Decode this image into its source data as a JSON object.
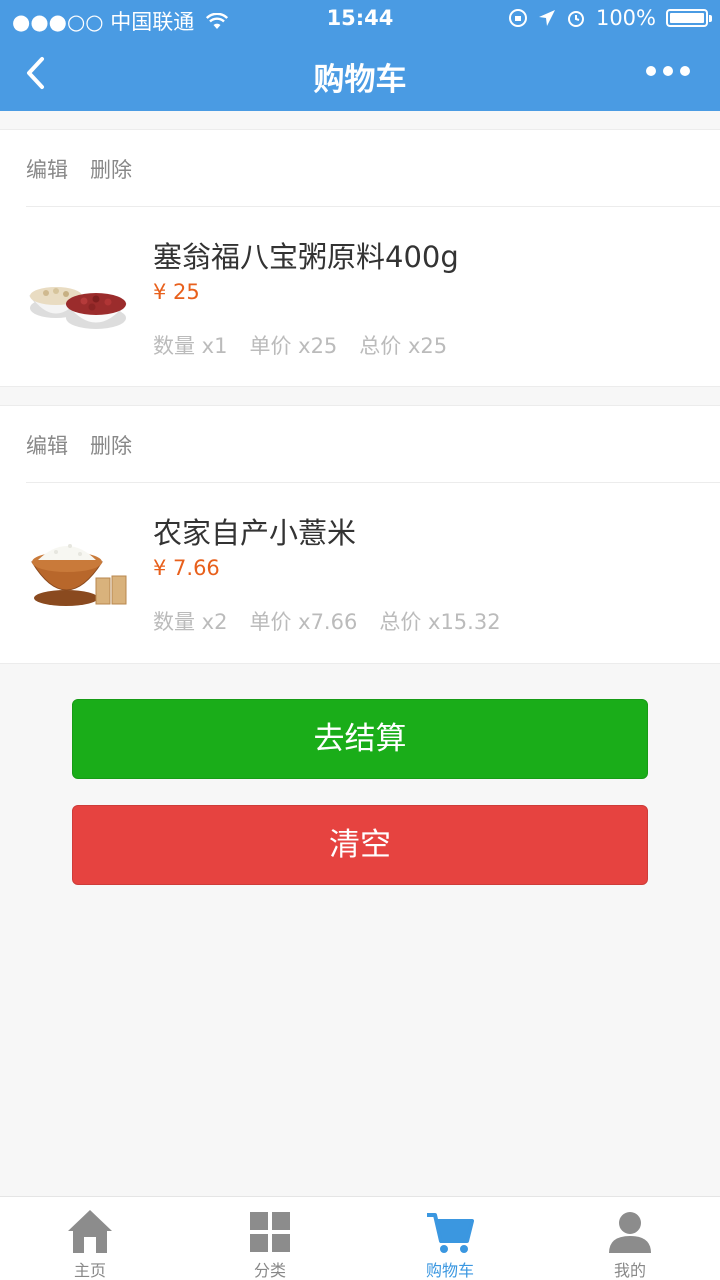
{
  "status_bar": {
    "carrier": "●●●○○ 中国联通",
    "time": "15:44",
    "battery": "100%"
  },
  "nav": {
    "title": "购物车",
    "back_icon": "chevron-left-icon",
    "more_icon": "more-dots-icon"
  },
  "cart": {
    "items": [
      {
        "edit_label": "编辑",
        "delete_label": "删除",
        "name": "塞翁福八宝粥原料400g",
        "price": "¥ 25",
        "quantity": "数量 x1",
        "unit_price": "单价 x25",
        "total": "总价 x25",
        "image": "beans-bowls-image"
      },
      {
        "edit_label": "编辑",
        "delete_label": "删除",
        "name": "农家自产小薏米",
        "price": "¥ 7.66",
        "quantity": "数量 x2",
        "unit_price": "单价 x7.66",
        "total": "总价 x15.32",
        "image": "rice-bowl-image"
      }
    ]
  },
  "buttons": {
    "checkout": "去结算",
    "clear": "清空"
  },
  "tabbar": {
    "active_color": "#3b97e0",
    "items": [
      {
        "label": "主页",
        "icon": "home-icon"
      },
      {
        "label": "分类",
        "icon": "grid-icon"
      },
      {
        "label": "购物车",
        "icon": "cart-icon"
      },
      {
        "label": "我的",
        "icon": "user-icon"
      }
    ]
  },
  "colors": {
    "primary": "#4a9be3",
    "price": "#e8601c",
    "checkout": "#1aad19",
    "clear": "#e64340"
  }
}
